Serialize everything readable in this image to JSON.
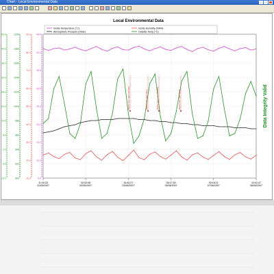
{
  "window": {
    "title": "Chart - Local Environmental Data"
  },
  "toolbar": {
    "tools": [
      "save-icon",
      "print-icon",
      "copy-icon",
      "zoom-in-icon",
      "zoom-out-icon",
      "pan-icon",
      "select-icon",
      "refresh-icon",
      "marker-icon",
      "legend-icon",
      "grid-icon",
      "export-icon",
      "settings-icon",
      "help-icon"
    ]
  },
  "status": {
    "label": "Data Integrity Valid"
  },
  "chart_data": {
    "type": "line",
    "title": "Local Environmental Data",
    "xlabel": "",
    "ylabel": "",
    "grid": true,
    "legend_position": "top",
    "x_ticks": [
      {
        "time": "11:00:33",
        "date": "31/05/2007"
      },
      {
        "time": "02:53:08",
        "date": "02/06/2007"
      },
      {
        "time": "16:40:27",
        "date": "03/06/2007"
      },
      {
        "time": "06:17:54",
        "date": "05/06/2007"
      },
      {
        "time": "00:18:21",
        "date": "07/06/2007"
      },
      {
        "time": "10:02:47",
        "date": "08/06/2007"
      }
    ],
    "axes": [
      {
        "series": "Inside Humidity (%RH)",
        "color": "#22aa22",
        "ylim": [
          -8,
          50
        ],
        "ticks": [
          "50.0",
          "44.0",
          "38.0",
          "32.0",
          "26.0",
          "20.0",
          "14.0",
          "8.0",
          "2.0",
          "-4.0",
          "-10.0"
        ]
      },
      {
        "series": "Atmospheric Pressure (mbar)",
        "color": "#228822",
        "ylim": [
          960,
          1100
        ],
        "ticks": [
          "1100",
          "1080",
          "1060",
          "1040",
          "1020",
          "1000",
          "980",
          "960",
          "940",
          "920",
          "900"
        ]
      },
      {
        "series": "Outside Temp (°C)",
        "color": "#e05050",
        "ylim": [
          0,
          100
        ],
        "ticks": [
          "90.0",
          "80.0",
          "70.0",
          "60.0",
          "50.0",
          "40.0",
          "30.0",
          "20.0",
          "10.0"
        ]
      },
      {
        "series": "Inside Temperature (°C)",
        "color": "#cc44cc",
        "ylim": [
          0,
          40
        ],
        "ticks": [
          "45.0",
          "40.0",
          "35.0",
          "30.0",
          "25.0",
          "20.0",
          "15.0",
          "10.0",
          "5.0"
        ]
      }
    ],
    "x": [
      0,
      0.5,
      1,
      1.5,
      2,
      2.5,
      3,
      3.5,
      4,
      4.5,
      5,
      5.5,
      6,
      6.5,
      7,
      7.5,
      8,
      8.5,
      9,
      9.5,
      10,
      10.5,
      11,
      11.5,
      12,
      12.5,
      13,
      13.5,
      14,
      14.5,
      15,
      15.5,
      16,
      16.5,
      17,
      17.5,
      18,
      18.5,
      19,
      19.5,
      20
    ],
    "series": [
      {
        "name": "Inside Temperature (°C)",
        "color": "#cc44cc",
        "values": [
          36,
          35.5,
          36,
          36.2,
          35.6,
          35.9,
          36.4,
          35.8,
          35.4,
          36,
          36.6,
          35.8,
          35.3,
          36.1,
          36.5,
          35.7,
          35.6,
          36.3,
          36.7,
          35.9,
          35.4,
          36,
          36.5,
          35.8,
          35.5,
          36.2,
          36.6,
          35.8,
          35.2,
          36,
          36.4,
          35.7,
          35.3,
          36.1,
          36.6,
          35.9,
          35.4,
          36,
          36.3,
          35.6,
          35.9
        ]
      },
      {
        "name": "Atmospheric Pressure (mbar)",
        "color": "#222222",
        "values": [
          1004,
          1005,
          1006,
          1008,
          1010,
          1011,
          1012,
          1014,
          1015,
          1016,
          1016,
          1017,
          1017,
          1017,
          1018,
          1018,
          1018,
          1018,
          1017,
          1017,
          1016,
          1016,
          1015,
          1015,
          1014,
          1014,
          1013,
          1013,
          1012,
          1012,
          1011,
          1011,
          1011,
          1010,
          1010,
          1010,
          1009,
          1009,
          1009,
          1008,
          1008
        ]
      },
      {
        "name": "Inside Humidity (%RH)",
        "color": "#e05050",
        "values": [
          16,
          17.5,
          15,
          13.5,
          16.5,
          17.8,
          14,
          12.8,
          17,
          19,
          14.8,
          12.5,
          16.2,
          18.5,
          14.5,
          12.2,
          15.8,
          19.5,
          14.2,
          12.8,
          16.5,
          18.2,
          15,
          13.2,
          16,
          19,
          14.8,
          12.5,
          16.2,
          17.5,
          14.6,
          13,
          15.8,
          18.4,
          15,
          13,
          16.2,
          17.8,
          14.8,
          13.2,
          16
        ]
      },
      {
        "name": "Outside Temp (°C)",
        "color": "#2a8f2a",
        "values": [
          14,
          16,
          28,
          33,
          22,
          10,
          8,
          14,
          30,
          35,
          20,
          8,
          10,
          18,
          32,
          36,
          18,
          6,
          9,
          16,
          30,
          34,
          17,
          7,
          10,
          19,
          31,
          35,
          18,
          8,
          9,
          15,
          28,
          33,
          20,
          9,
          10,
          16,
          26,
          31,
          25
        ]
      }
    ],
    "annotations": [
      "Mains Fail: High Humidity",
      "Mains Fail: High Temp",
      "Mains Fail: Low Humidity",
      "Mains Fail: High Temp"
    ]
  }
}
